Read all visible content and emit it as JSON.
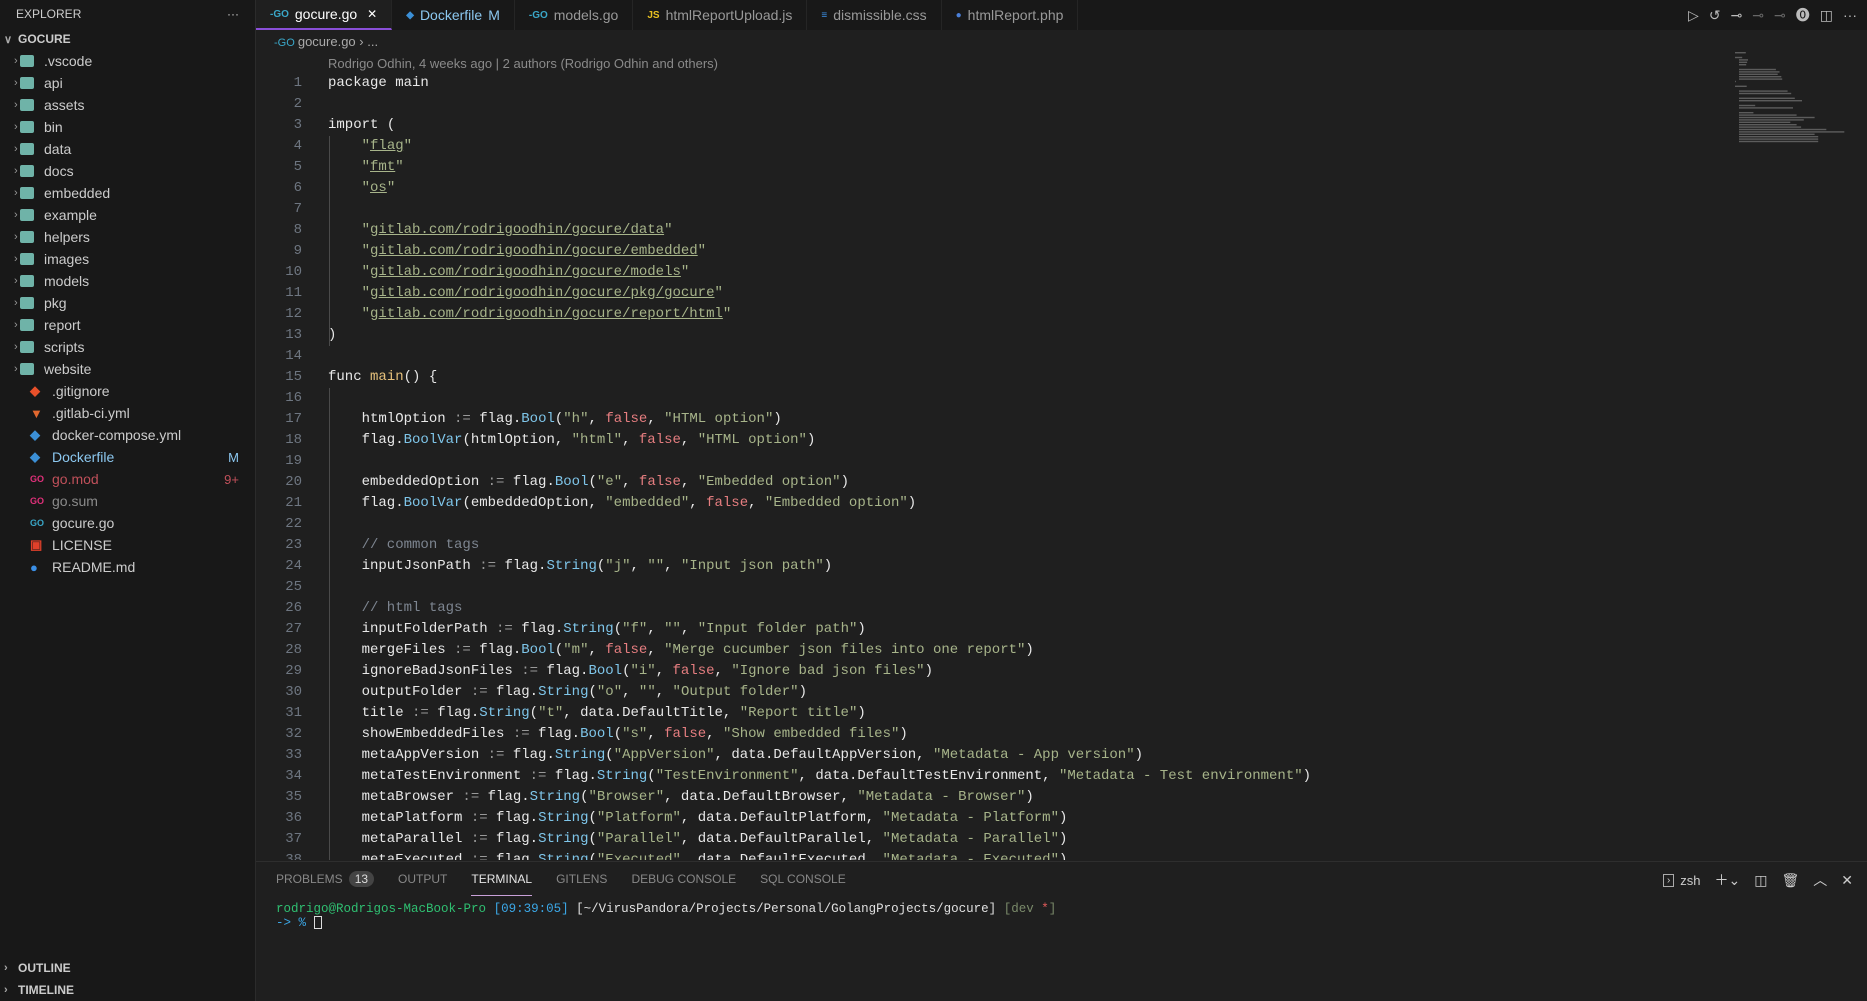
{
  "sidebar": {
    "title": "EXPLORER",
    "more": "···",
    "root": "GOCURE",
    "folders": [
      ".vscode",
      "api",
      "assets",
      "bin",
      "data",
      "docs",
      "embedded",
      "example",
      "helpers",
      "images",
      "models",
      "pkg",
      "report",
      "scripts",
      "website"
    ],
    "files": [
      {
        "name": ".gitignore",
        "icon": "git-icon",
        "color": "#ccc",
        "iconColor": "#e8502a"
      },
      {
        "name": ".gitlab-ci.yml",
        "icon": "gitlab-icon",
        "color": "#ccc",
        "iconColor": "#e2682f"
      },
      {
        "name": "docker-compose.yml",
        "icon": "docker-icon",
        "color": "#ccc",
        "iconColor": "#3b8fd6"
      },
      {
        "name": "Dockerfile",
        "icon": "docker-icon",
        "color": "#8cc8f0",
        "iconColor": "#3b8fd6",
        "badge": "M",
        "badgeColor": "#8cc8f0"
      },
      {
        "name": "go.mod",
        "icon": "go-icon",
        "color": "#c0505a",
        "iconColor": "#e0307a",
        "badge": "9+",
        "badgeColor": "#c0505a"
      },
      {
        "name": "go.sum",
        "icon": "go-icon",
        "color": "#8a8a8a",
        "iconColor": "#e0307a"
      },
      {
        "name": "gocure.go",
        "icon": "go-icon",
        "color": "#ccc",
        "iconColor": "#3aa7c8"
      },
      {
        "name": "LICENSE",
        "icon": "license-icon",
        "color": "#ccc",
        "iconColor": "#e0402a"
      },
      {
        "name": "README.md",
        "icon": "info-icon",
        "color": "#ccc",
        "iconColor": "#3b8fe6"
      }
    ],
    "outline": "OUTLINE",
    "timeline": "TIMELINE"
  },
  "tabs": [
    {
      "label": "gocure.go",
      "icon": "go-icon",
      "active": true,
      "close": "✕"
    },
    {
      "label": "Dockerfile",
      "badge": "M",
      "icon": "docker-icon"
    },
    {
      "label": "models.go",
      "icon": "go-icon"
    },
    {
      "label": "htmlReportUpload.js",
      "icon": "js-icon"
    },
    {
      "label": "dismissible.css",
      "icon": "css-icon"
    },
    {
      "label": "htmlReport.php",
      "icon": "php-icon"
    }
  ],
  "breadcrumb": {
    "file": "gocure.go",
    "sep": "›",
    "rest": "..."
  },
  "blame": "Rodrigo Odhin, 4 weeks ago | 2 authors (Rodrigo Odhin and others)",
  "code": [
    "package main",
    "",
    "import (",
    "\t\"flag\"",
    "\t\"fmt\"",
    "\t\"os\"",
    "",
    "\t\"gitlab.com/rodrigoodhin/gocure/data\"",
    "\t\"gitlab.com/rodrigoodhin/gocure/embedded\"",
    "\t\"gitlab.com/rodrigoodhin/gocure/models\"",
    "\t\"gitlab.com/rodrigoodhin/gocure/pkg/gocure\"",
    "\t\"gitlab.com/rodrigoodhin/gocure/report/html\"",
    ")",
    "",
    "func main() {",
    "",
    "\thtmlOption := flag.Bool(\"h\", false, \"HTML option\")",
    "\tflag.BoolVar(htmlOption, \"html\", false, \"HTML option\")",
    "",
    "\tembeddedOption := flag.Bool(\"e\", false, \"Embedded option\")",
    "\tflag.BoolVar(embeddedOption, \"embedded\", false, \"Embedded option\")",
    "",
    "\t// common tags",
    "\tinputJsonPath := flag.String(\"j\", \"\", \"Input json path\")",
    "",
    "\t// html tags",
    "\tinputFolderPath := flag.String(\"f\", \"\", \"Input folder path\")",
    "\tmergeFiles := flag.Bool(\"m\", false, \"Merge cucumber json files into one report\")",
    "\tignoreBadJsonFiles := flag.Bool(\"i\", false, \"Ignore bad json files\")",
    "\toutputFolder := flag.String(\"o\", \"\", \"Output folder\")",
    "\ttitle := flag.String(\"t\", data.DefaultTitle, \"Report title\")",
    "\tshowEmbeddedFiles := flag.Bool(\"s\", false, \"Show embedded files\")",
    "\tmetaAppVersion := flag.String(\"AppVersion\", data.DefaultAppVersion, \"Metadata - App version\")",
    "\tmetaTestEnvironment := flag.String(\"TestEnvironment\", data.DefaultTestEnvironment, \"Metadata - Test environment\")",
    "\tmetaBrowser := flag.String(\"Browser\", data.DefaultBrowser, \"Metadata - Browser\")",
    "\tmetaPlatform := flag.String(\"Platform\", data.DefaultPlatform, \"Metadata - Platform\")",
    "\tmetaParallel := flag.String(\"Parallel\", data.DefaultParallel, \"Metadata - Parallel\")",
    "\tmetaExecuted := flag.String(\"Executed\", data.DefaultExecuted, \"Metadata - Executed\")"
  ],
  "panel": {
    "tabs": [
      {
        "label": "PROBLEMS",
        "count": "13"
      },
      {
        "label": "OUTPUT"
      },
      {
        "label": "TERMINAL",
        "active": true
      },
      {
        "label": "GITLENS"
      },
      {
        "label": "DEBUG CONSOLE"
      },
      {
        "label": "SQL CONSOLE"
      }
    ],
    "shell": "zsh",
    "terminal": {
      "user": "rodrigo@Rodrigos-MacBook-Pro",
      "time": "[09:39:05]",
      "path": "[~/VirusPandora/Projects/Personal/GolangProjects/gocure]",
      "branch_open": "[dev",
      "dirty": "*",
      "branch_close": "]",
      "prompt": "-> %"
    }
  }
}
